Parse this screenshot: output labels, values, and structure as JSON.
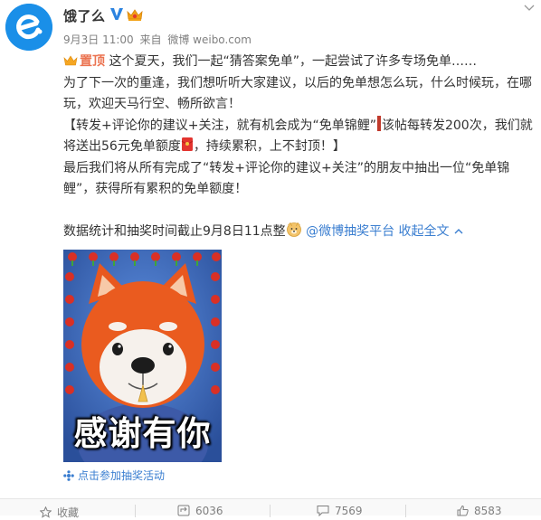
{
  "post": {
    "author": {
      "name": "饿了么"
    },
    "meta": {
      "date": "9月3日 11:00",
      "source_prefix": "来自",
      "source": "微博 weibo.com"
    },
    "pin_label": "置顶",
    "paragraphs": {
      "p1": "这个夏天，我们一起“猜答案免单”，一起尝试了许多专场免单……",
      "p2": "为了下一次的重逢，我们想听听大家建议，以后的免单想怎么玩，什么时候玩，在哪玩，欢迎天马行空、畅所欲言！",
      "p3a": "【转发+评论你的建议+关注，就有机会成为“免单锦鲤”",
      "p3b": "该帖每转发200次，我们就将送出56元免单额度",
      "p3c": "，持续累积，上不封顶！】",
      "p4": "最后我们将从所有完成了“转发+评论你的建议+关注”的朋友中抽出一位“免单锦鲤”，获得所有累积的免单额度！",
      "p5a": "数据统计和抽奖时间截止9月8日11点整",
      "p5_link": "@微博抽奖平台",
      "p5_collapse": "收起全文"
    },
    "image": {
      "caption": "感谢有你"
    },
    "lottery_link": "点击参加抽奖活动"
  },
  "actions": {
    "favorite": "收藏",
    "repost": "6036",
    "comment": "7569",
    "like": "8583"
  },
  "colors": {
    "brand_blue": "#1a8fe8",
    "link_blue": "#3a7ed0",
    "pin_orange": "#eb7350"
  }
}
